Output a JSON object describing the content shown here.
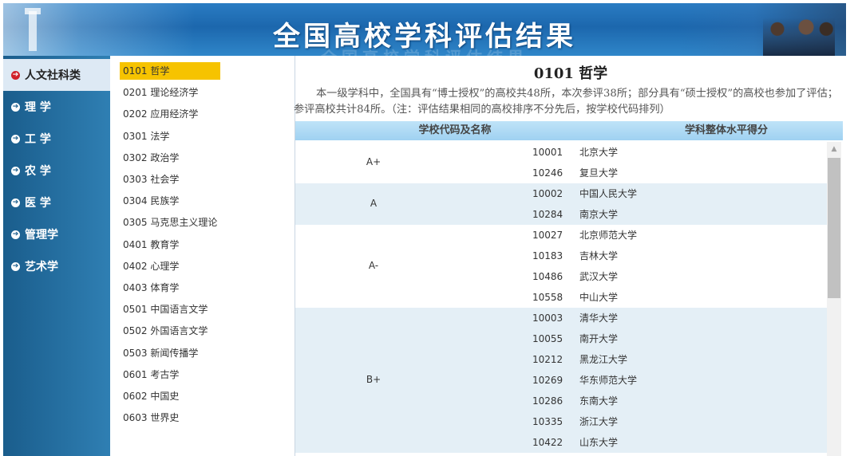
{
  "banner": {
    "title": "全国高校学科评估结果"
  },
  "categories": [
    {
      "label": "人文社科类",
      "active": true
    },
    {
      "label": "理 学",
      "active": false
    },
    {
      "label": "工 学",
      "active": false
    },
    {
      "label": "农 学",
      "active": false
    },
    {
      "label": "医 学",
      "active": false
    },
    {
      "label": "管理学",
      "active": false
    },
    {
      "label": "艺术学",
      "active": false
    }
  ],
  "subjects": [
    "0101 哲学",
    "0201 理论经济学",
    "0202 应用经济学",
    "0301 法学",
    "0302 政治学",
    "0303 社会学",
    "0304 民族学",
    "0305 马克思主义理论",
    "0401 教育学",
    "0402 心理学",
    "0403 体育学",
    "0501 中国语言文学",
    "0502 外国语言文学",
    "0503 新闻传播学",
    "0601 考古学",
    "0602 中国史",
    "0603 世界史"
  ],
  "main": {
    "heading": "0101 哲学",
    "description": "本一级学科中，全国具有“博士授权”的高校共48所，本次参评38所；部分具有“硕士授权”的高校也参加了评估；参评高校共计84所。（注：评估结果相同的高校排序不分先后，按学校代码排列）",
    "col_school": "学校代码及名称",
    "col_score": "学科整体水平得分"
  },
  "results": [
    {
      "grade": "A+",
      "schools": [
        {
          "code": "10001",
          "name": "北京大学"
        },
        {
          "code": "10246",
          "name": "复旦大学"
        }
      ]
    },
    {
      "grade": "A",
      "schools": [
        {
          "code": "10002",
          "name": "中国人民大学"
        },
        {
          "code": "10284",
          "name": "南京大学"
        }
      ]
    },
    {
      "grade": "A-",
      "schools": [
        {
          "code": "10027",
          "name": "北京师范大学"
        },
        {
          "code": "10183",
          "name": "吉林大学"
        },
        {
          "code": "10486",
          "name": "武汉大学"
        },
        {
          "code": "10558",
          "name": "中山大学"
        }
      ]
    },
    {
      "grade": "B+",
      "schools": [
        {
          "code": "10003",
          "name": "清华大学"
        },
        {
          "code": "10055",
          "name": "南开大学"
        },
        {
          "code": "10212",
          "name": "黑龙江大学"
        },
        {
          "code": "10269",
          "name": "华东师范大学"
        },
        {
          "code": "10286",
          "name": "东南大学"
        },
        {
          "code": "10335",
          "name": "浙江大学"
        },
        {
          "code": "10422",
          "name": "山东大学"
        }
      ]
    }
  ],
  "colors": {
    "active_subject": "#f6c300",
    "header_bar": "#9fd1f1",
    "shaded_row": "#e4eff6",
    "sidebar": "#1a5d8c"
  }
}
